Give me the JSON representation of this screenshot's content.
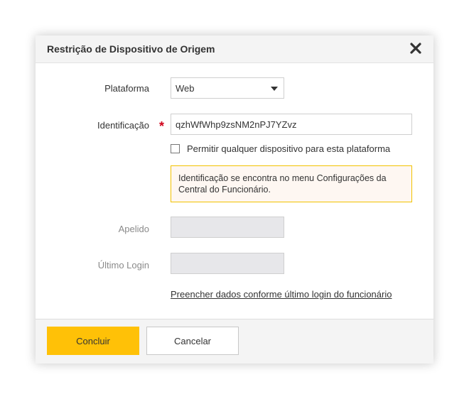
{
  "dialog": {
    "title": "Restrição de Dispositivo de Origem",
    "close_icon": "close-icon"
  },
  "form": {
    "platform": {
      "label": "Plataforma",
      "value": "Web"
    },
    "identification": {
      "label": "Identificação",
      "required_mark": "*",
      "value": "qzhWfWhp9zsNM2nPJ7YZvz"
    },
    "allow_any": {
      "label": "Permitir qualquer dispositivo para esta plataforma",
      "checked": false
    },
    "info_text": "Identificação se encontra no menu Configurações da Central do Funcionário.",
    "nickname": {
      "label": "Apelido",
      "value": ""
    },
    "last_login": {
      "label": "Último Login",
      "value": ""
    },
    "fill_link": "Preencher dados conforme último login do funcionário"
  },
  "footer": {
    "confirm_label": "Concluir",
    "cancel_label": "Cancelar"
  },
  "colors": {
    "accent": "#ffc107",
    "required": "#d0021b",
    "info_border": "#f2c200",
    "info_bg": "#fef7f2"
  }
}
